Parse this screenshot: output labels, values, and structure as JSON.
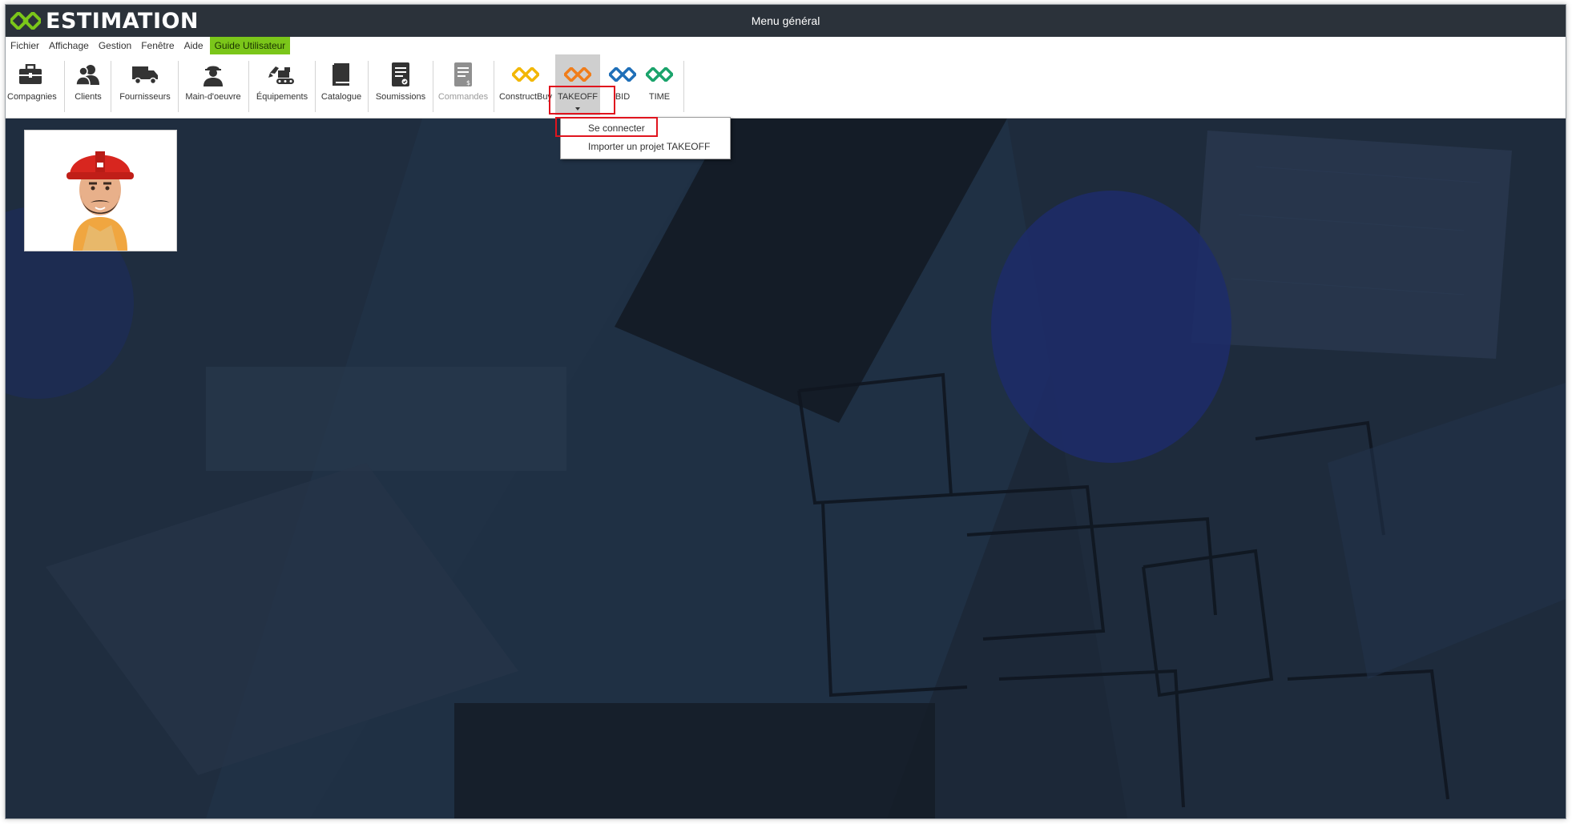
{
  "app": {
    "logo_text": "ESTIMATION",
    "window_title": "Menu général"
  },
  "menubar": {
    "items": [
      "Fichier",
      "Affichage",
      "Gestion",
      "Fenêtre",
      "Aide"
    ],
    "guide": "Guide Utilisateur"
  },
  "ribbon": {
    "buttons": [
      {
        "label": "Compagnies",
        "icon": "briefcase-icon"
      },
      {
        "label": "Clients",
        "icon": "people-icon"
      },
      {
        "label": "Fournisseurs",
        "icon": "truck-icon"
      },
      {
        "label": "Main-d'oeuvre",
        "icon": "worker-icon"
      },
      {
        "label": "Équipements",
        "icon": "excavator-icon"
      },
      {
        "label": "Catalogue",
        "icon": "book-icon"
      },
      {
        "label": "Soumissions",
        "icon": "document-icon"
      },
      {
        "label": "Commandes",
        "icon": "invoice-icon"
      },
      {
        "label": "ConstructBuy",
        "icon": "constructbuy-logo-icon"
      },
      {
        "label": "TAKEOFF",
        "icon": "takeoff-logo-icon"
      },
      {
        "label": "BID",
        "icon": "bid-logo-icon"
      },
      {
        "label": "TIME",
        "icon": "time-logo-icon"
      }
    ]
  },
  "dropdown": {
    "items": [
      "Se connecter",
      "Importer un projet TAKEOFF"
    ]
  },
  "colors": {
    "titlebar": "#2b323a",
    "guide_highlight": "#7bc61a",
    "logo_green": "#7bc61a",
    "constructbuy": "#f2b705",
    "takeoff": "#f07d1a",
    "bid": "#1f6fb8",
    "time": "#1aa36b",
    "highlight_box": "#e0141e",
    "background": "#1d2a3a"
  }
}
